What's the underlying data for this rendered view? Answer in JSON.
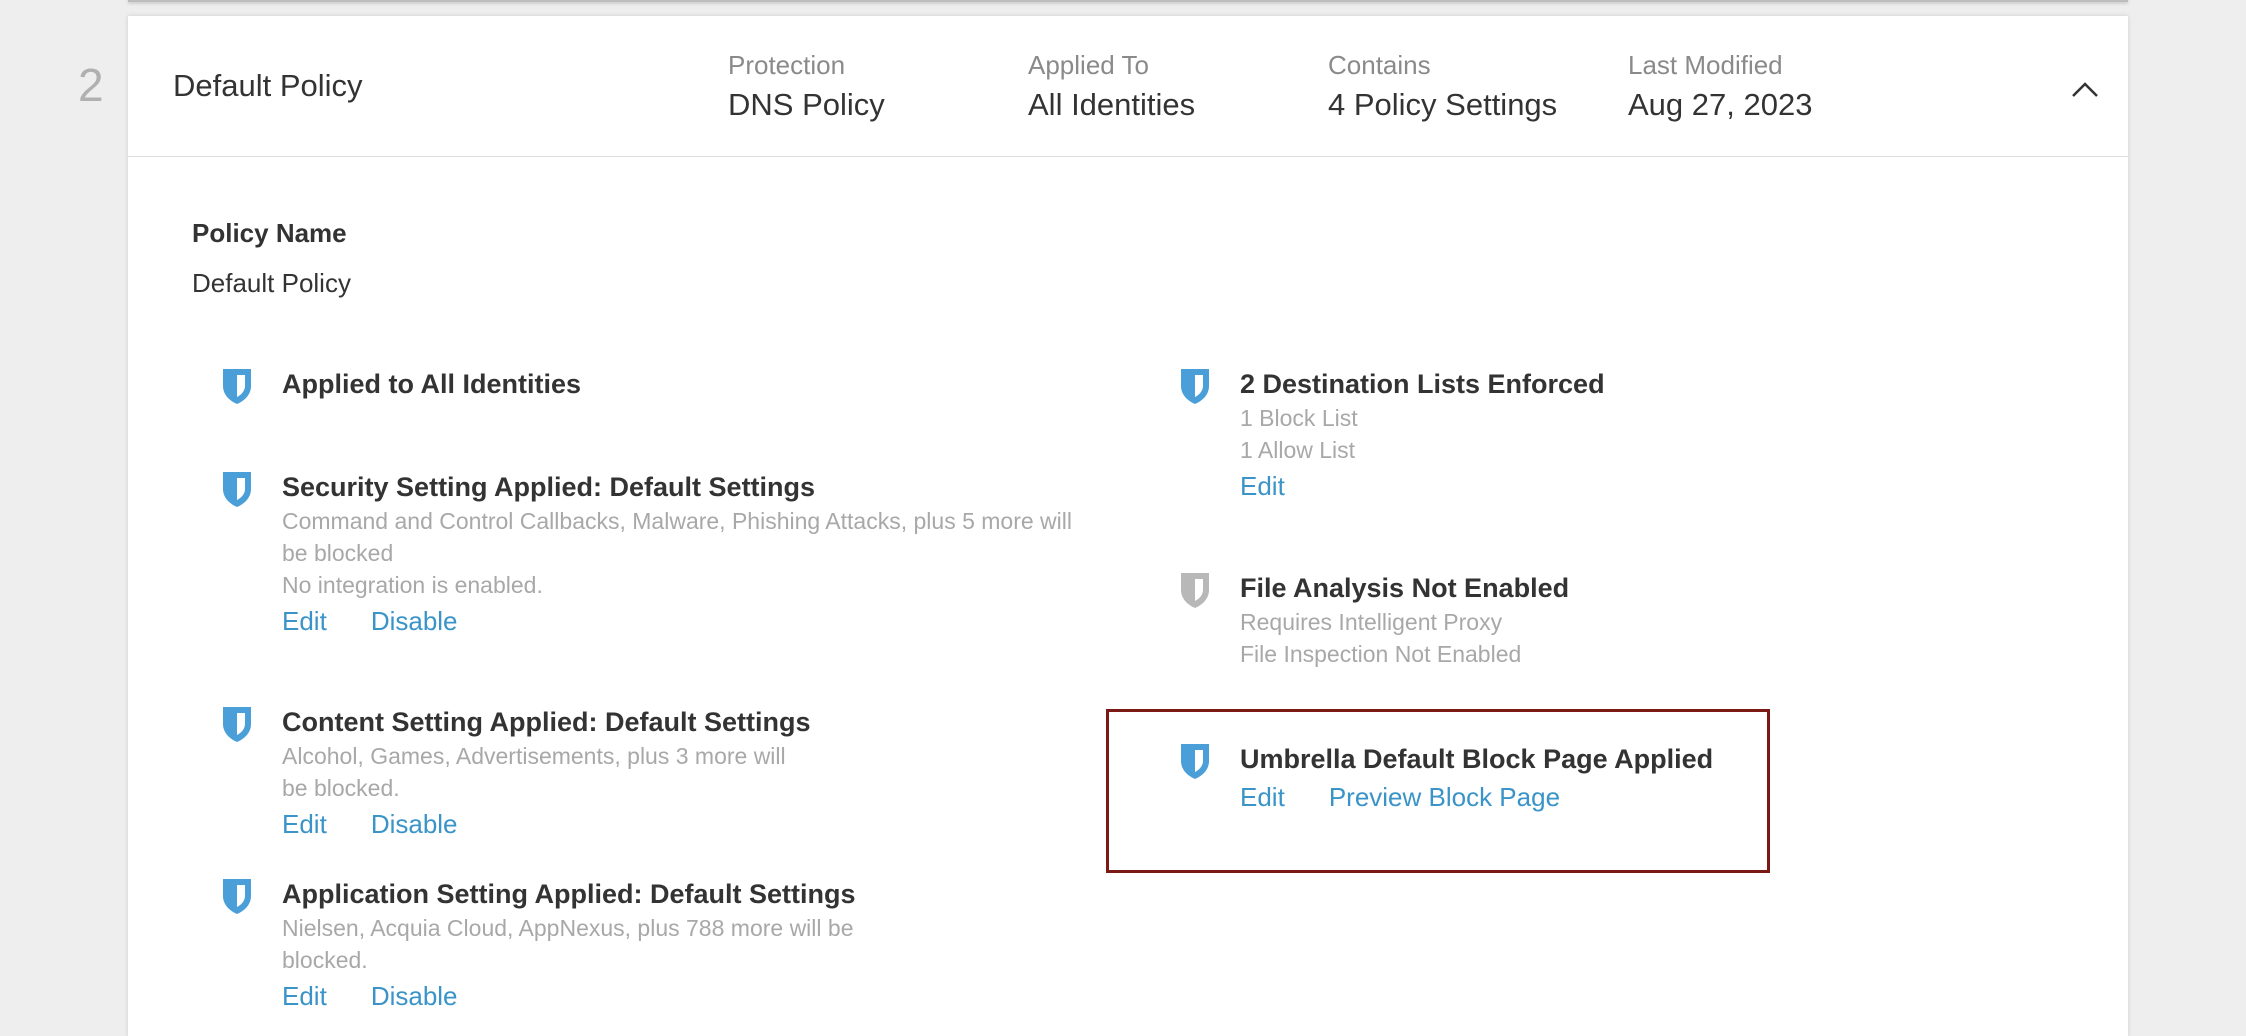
{
  "row_index": "2",
  "header": {
    "policy_title": "Default Policy",
    "columns": [
      {
        "label": "Protection",
        "value": "DNS Policy"
      },
      {
        "label": "Applied To",
        "value": "All Identities"
      },
      {
        "label": "Contains",
        "value": "4 Policy Settings"
      },
      {
        "label": "Last Modified",
        "value": "Aug 27, 2023"
      }
    ],
    "collapse_icon": "chevron-up-icon"
  },
  "policy_name": {
    "label": "Policy Name",
    "value": "Default Policy"
  },
  "left_items": [
    {
      "title": "Applied to All Identities",
      "icon": "shield-icon",
      "icon_state": "enabled"
    },
    {
      "title": "Security Setting Applied: Default Settings",
      "desc": [
        "Command and Control Callbacks, Malware, Phishing Attacks, plus 5 more will be blocked",
        "No integration is enabled."
      ],
      "links": [
        "Edit",
        "Disable"
      ],
      "icon": "shield-icon",
      "icon_state": "enabled"
    },
    {
      "title": "Content Setting Applied: Default Settings",
      "desc": [
        "Alcohol, Games, Advertisements, plus 3 more will be blocked."
      ],
      "links": [
        "Edit",
        "Disable"
      ],
      "icon": "shield-icon",
      "icon_state": "enabled"
    },
    {
      "title": "Application Setting Applied: Default Settings",
      "desc": [
        "Nielsen, Acquia Cloud, AppNexus, plus 788 more will be blocked."
      ],
      "links": [
        "Edit",
        "Disable"
      ],
      "icon": "shield-icon",
      "icon_state": "enabled"
    }
  ],
  "right_items": [
    {
      "title": "2 Destination Lists Enforced",
      "desc": [
        "1 Block List",
        "1 Allow List"
      ],
      "links": [
        "Edit"
      ],
      "icon": "shield-icon",
      "icon_state": "enabled"
    },
    {
      "title": "File Analysis Not Enabled",
      "desc": [
        "Requires Intelligent Proxy",
        "File Inspection Not Enabled"
      ],
      "icon": "shield-icon",
      "icon_state": "disabled"
    },
    {
      "title": "Umbrella Default Block Page Applied",
      "links": [
        "Edit",
        "Preview Block Page"
      ],
      "icon": "shield-icon",
      "icon_state": "enabled"
    }
  ],
  "colors": {
    "shield_enabled": "#4a9fd8",
    "shield_disabled": "#b8b8b8",
    "link": "#3a94c8",
    "highlight_border": "#7b1a14"
  }
}
